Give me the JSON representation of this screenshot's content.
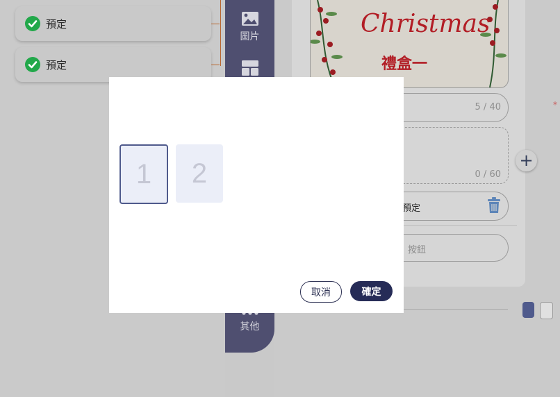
{
  "left_panel": {
    "items": [
      {
        "label": "預定"
      },
      {
        "label": "預定"
      }
    ]
  },
  "toolbar": {
    "image_label": "圖片",
    "other_label": "其他"
  },
  "card": {
    "image_title": "Christmas",
    "image_subtitle": "禮盒一",
    "title_counter": "5 / 40",
    "desc_counter": "0 / 60",
    "action_label": "預定",
    "button_placeholder": "按鈕"
  },
  "colors": {
    "accent_dark": "#262c57",
    "toolbar": "#4f4f70",
    "check_green": "#22a84a",
    "swatch_dark": "#4f5a8c"
  },
  "modal": {
    "pages": [
      "1",
      "2"
    ],
    "selected_page": "1",
    "cancel_label": "取消",
    "confirm_label": "確定"
  }
}
